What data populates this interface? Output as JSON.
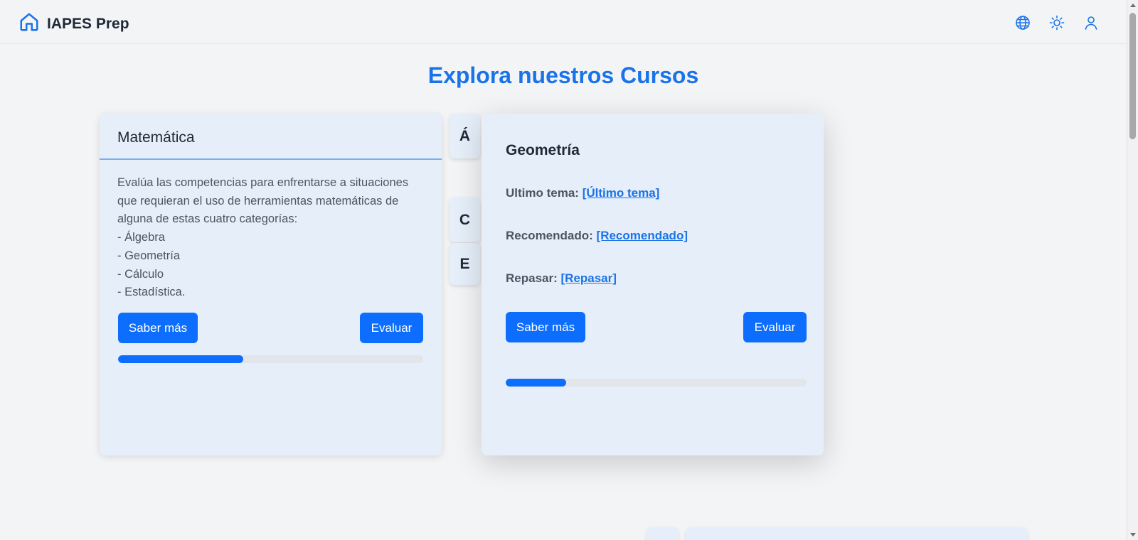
{
  "header": {
    "brand": "IAPES Prep",
    "icons": [
      "home-icon",
      "globe-icon",
      "sun-icon",
      "user-icon"
    ]
  },
  "page": {
    "title": "Explora nuestros Cursos"
  },
  "course_card": {
    "title": "Matemática",
    "description": "Evalúa las competencias para enfrentarse a situaciones que requieran el uso de herramientas matemáticas de alguna de estas cuatro categorías:\n- Álgebra\n- Geometría\n- Cálculo\n- Estadística.",
    "saber_mas_label": "Saber más",
    "evaluar_label": "Evaluar",
    "progress_fraction": 0.41
  },
  "category_tabs": [
    {
      "label": "Á"
    },
    {
      "label": "C"
    },
    {
      "label": "E"
    }
  ],
  "topic_card": {
    "title": "Geometría",
    "ultimo_tema_label": "Ultimo tema:",
    "ultimo_tema_link": "[Último tema]",
    "recomendado_label": "Recomendado:",
    "recomendado_link": "[Recomendado]",
    "repasar_label": "Repasar:",
    "repasar_link": "[Repasar]",
    "saber_mas_label": "Saber más",
    "evaluar_label": "Evaluar",
    "progress_fraction": 0.2
  },
  "colors": {
    "accent": "#0d6efd",
    "title": "#1a73e8",
    "card_bg": "#e6eff9",
    "page_bg": "#f3f4f6"
  }
}
